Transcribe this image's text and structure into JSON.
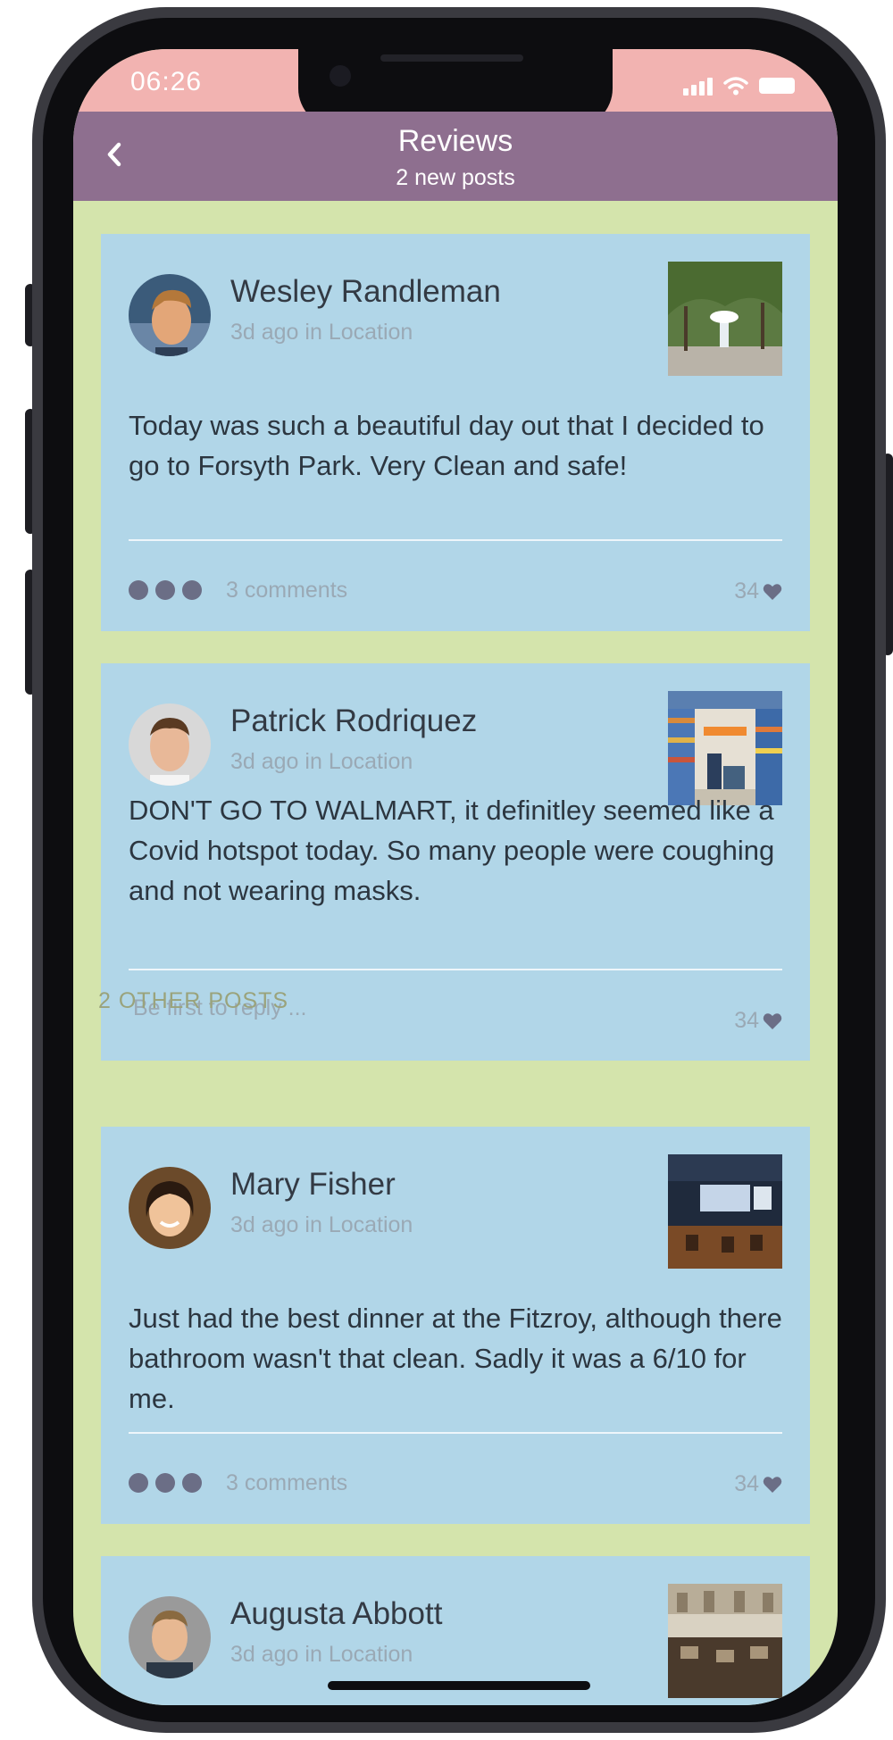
{
  "status_bar": {
    "time": "06:26"
  },
  "header": {
    "title": "Reviews",
    "subtitle": "2 new posts"
  },
  "posts": [
    {
      "author": "Wesley Randleman",
      "meta": "3d ago in Location",
      "text": "Today was such a beautiful day out that I decided to go to Forsyth Park. Very Clean and safe!",
      "comments": "3 comments",
      "likes": "34"
    },
    {
      "author": "Patrick Rodriquez",
      "meta": "3d ago in Location",
      "text": "DON'T GO TO WALMART, it definitley seemed like a Covid hotspot today. So many people were coughing and not wearing masks.",
      "reply_placeholder": "Be first to reply ...",
      "likes": "34"
    },
    {
      "author": "Mary Fisher",
      "meta": "3d ago in Location",
      "text": "Just had the best dinner at the Fitzroy, although there bathroom wasn't that clean. Sadly it was a 6/10 for me.",
      "comments": "3 comments",
      "likes": "34"
    },
    {
      "author": "Augusta Abbott",
      "meta": "3d ago in Location"
    }
  ],
  "other_posts_label": "2 OTHER POSTS",
  "colors": {
    "status_bar": "#f2b3b1",
    "nav_bar": "#8e6f8f",
    "background": "#d4e4ac",
    "card": "#b1d6e8"
  }
}
